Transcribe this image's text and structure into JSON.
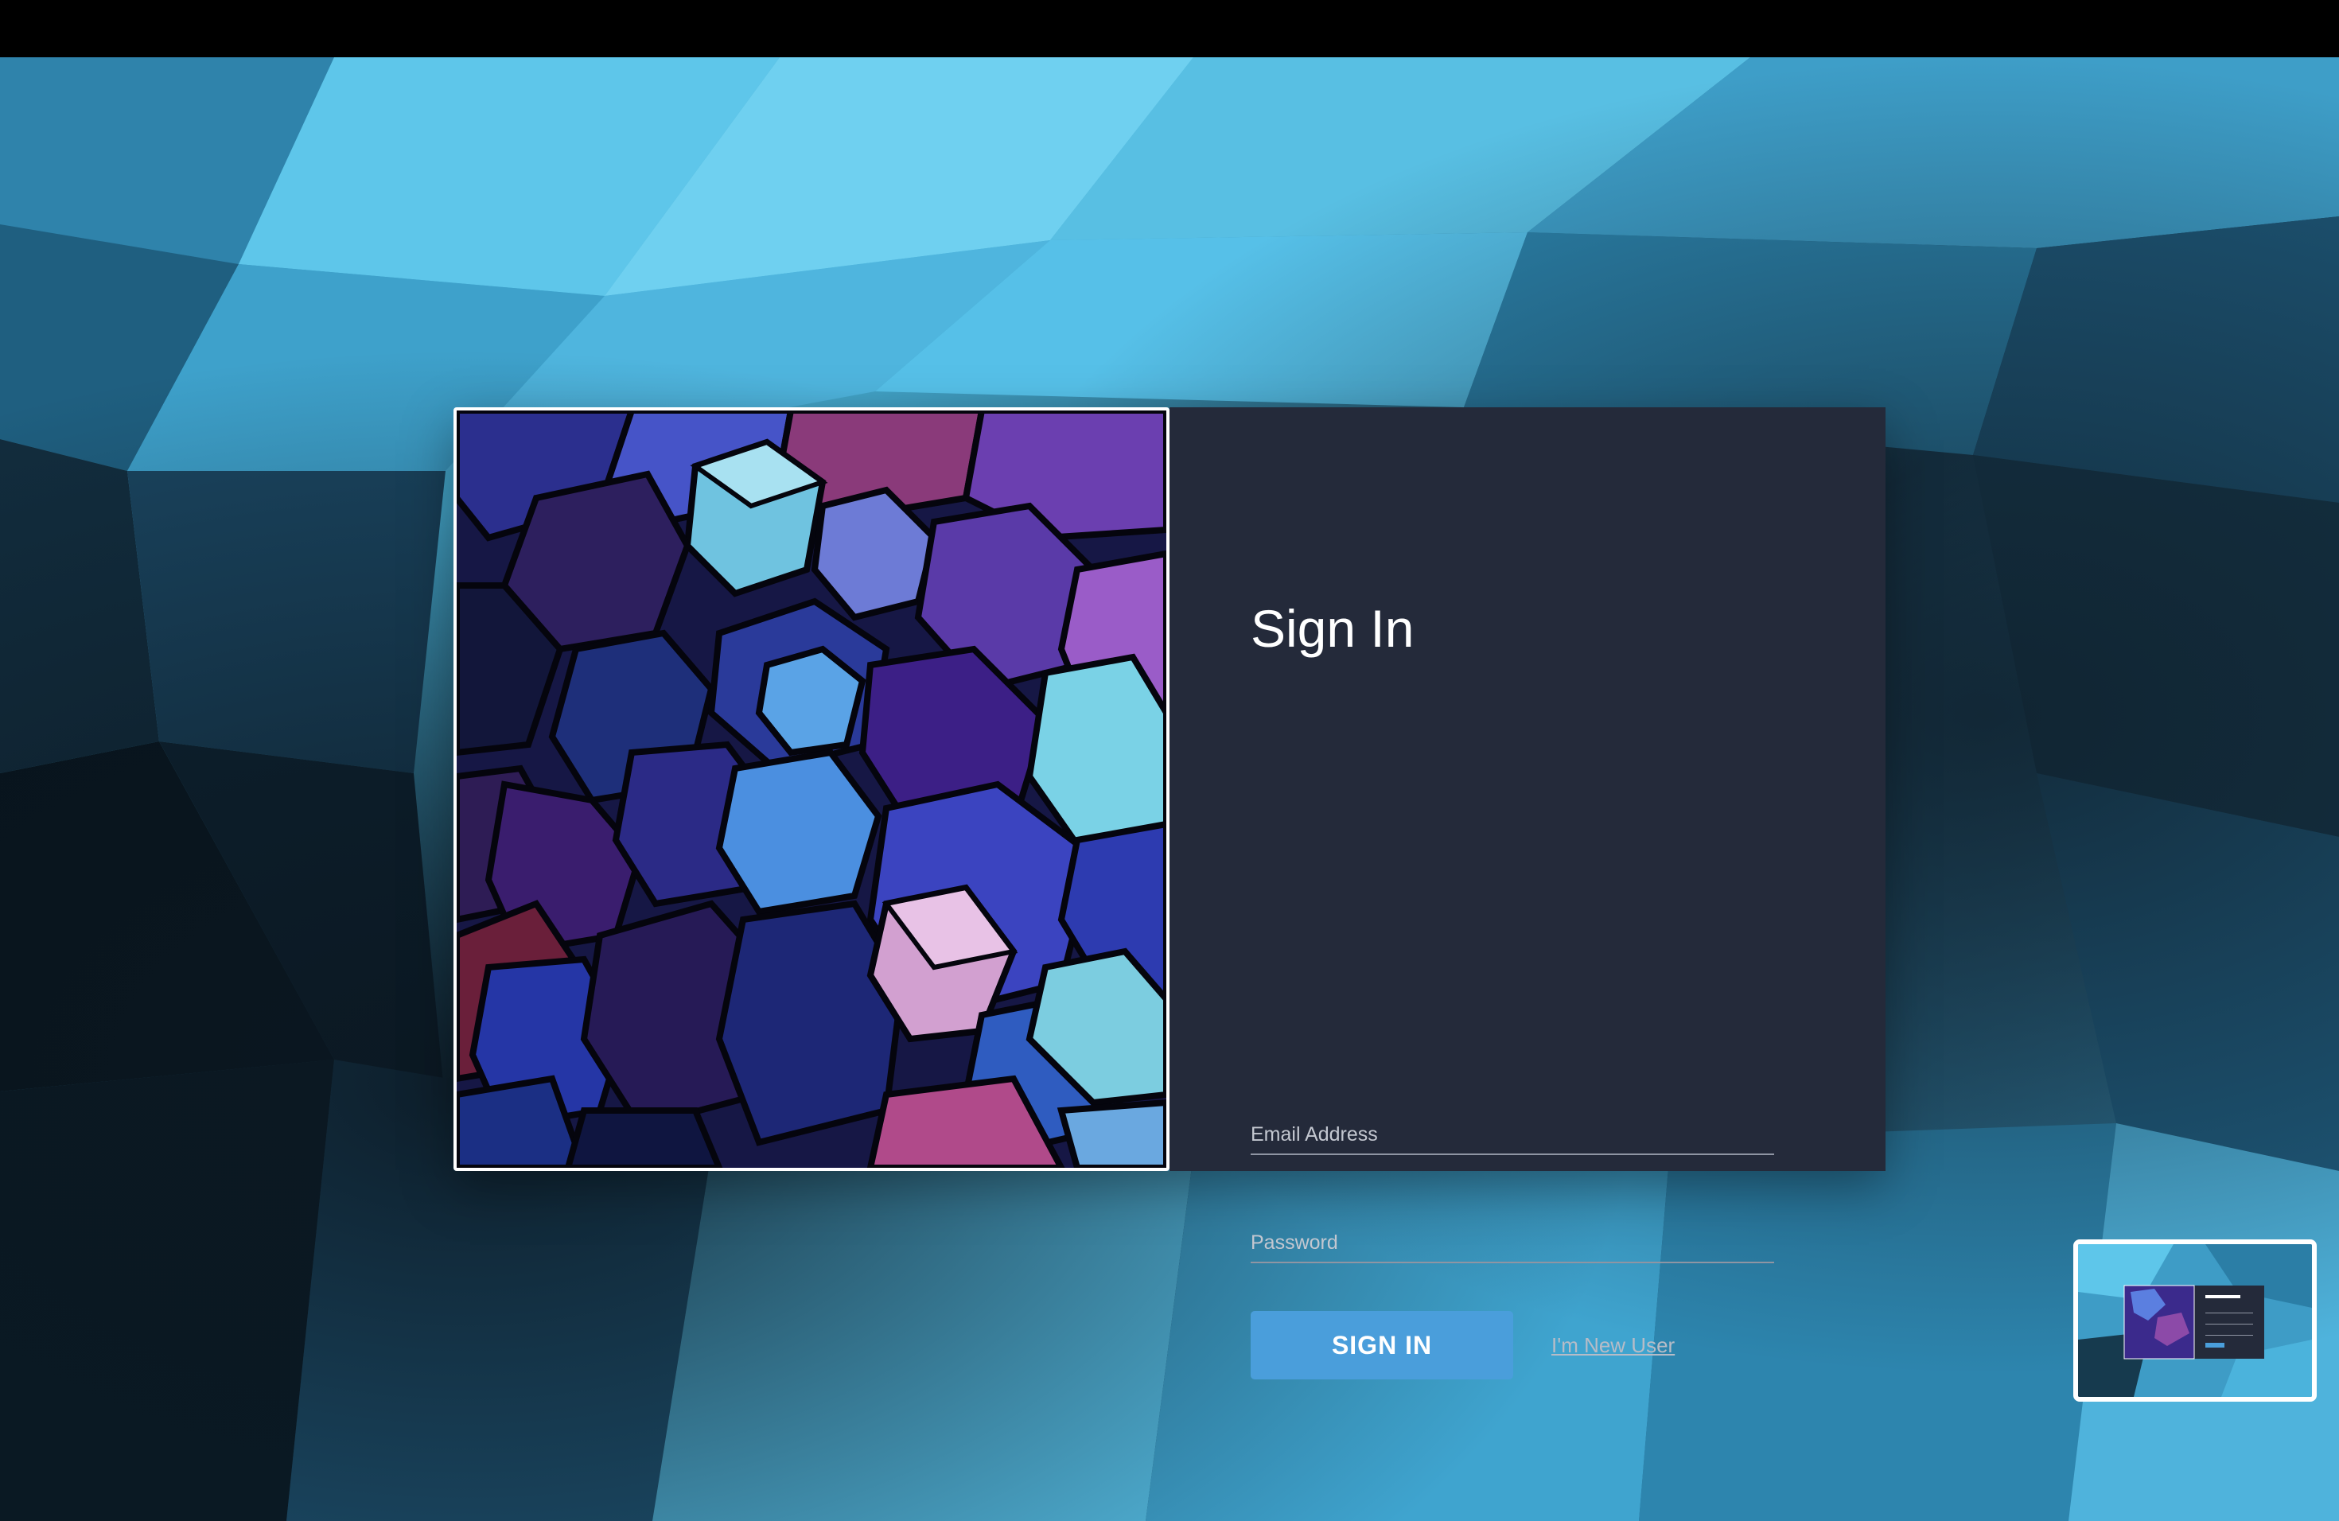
{
  "login": {
    "title": "Sign In",
    "email_placeholder": "Email Address",
    "email_value": "",
    "password_placeholder": "Password",
    "password_value": "",
    "submit_label": "SIGN IN",
    "new_user_label": "I'm New User"
  },
  "colors": {
    "panel_bg": "#242a3a",
    "accent": "#4a9edb",
    "text": "#ffffff",
    "muted_text": "#c3c7d0"
  },
  "thumbnail": {
    "icon": "window-preview-thumbnail"
  }
}
